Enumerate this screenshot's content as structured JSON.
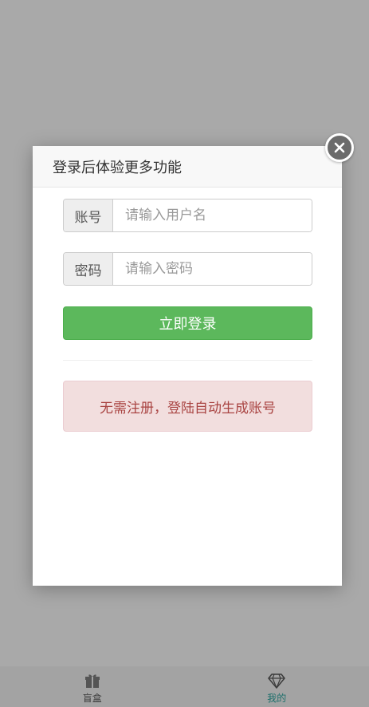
{
  "modal": {
    "title": "登录后体验更多功能",
    "username": {
      "addon": "账号",
      "placeholder": "请输入用户名",
      "value": ""
    },
    "password": {
      "addon": "密码",
      "placeholder": "请输入密码",
      "value": ""
    },
    "login_button": "立即登录",
    "notice": "无需注册，登陆自动生成账号",
    "close_icon": "close-icon"
  },
  "tabbar": {
    "items": [
      {
        "label": "盲盒",
        "icon": "gift-icon",
        "active": false
      },
      {
        "label": "我的",
        "icon": "diamond-icon",
        "active": true
      }
    ]
  },
  "colors": {
    "overlay": "#a9a9a9",
    "success": "#5cb85c",
    "alert_bg": "#f2dede",
    "alert_text": "#a94442",
    "tab_active": "#1d6f6b"
  }
}
